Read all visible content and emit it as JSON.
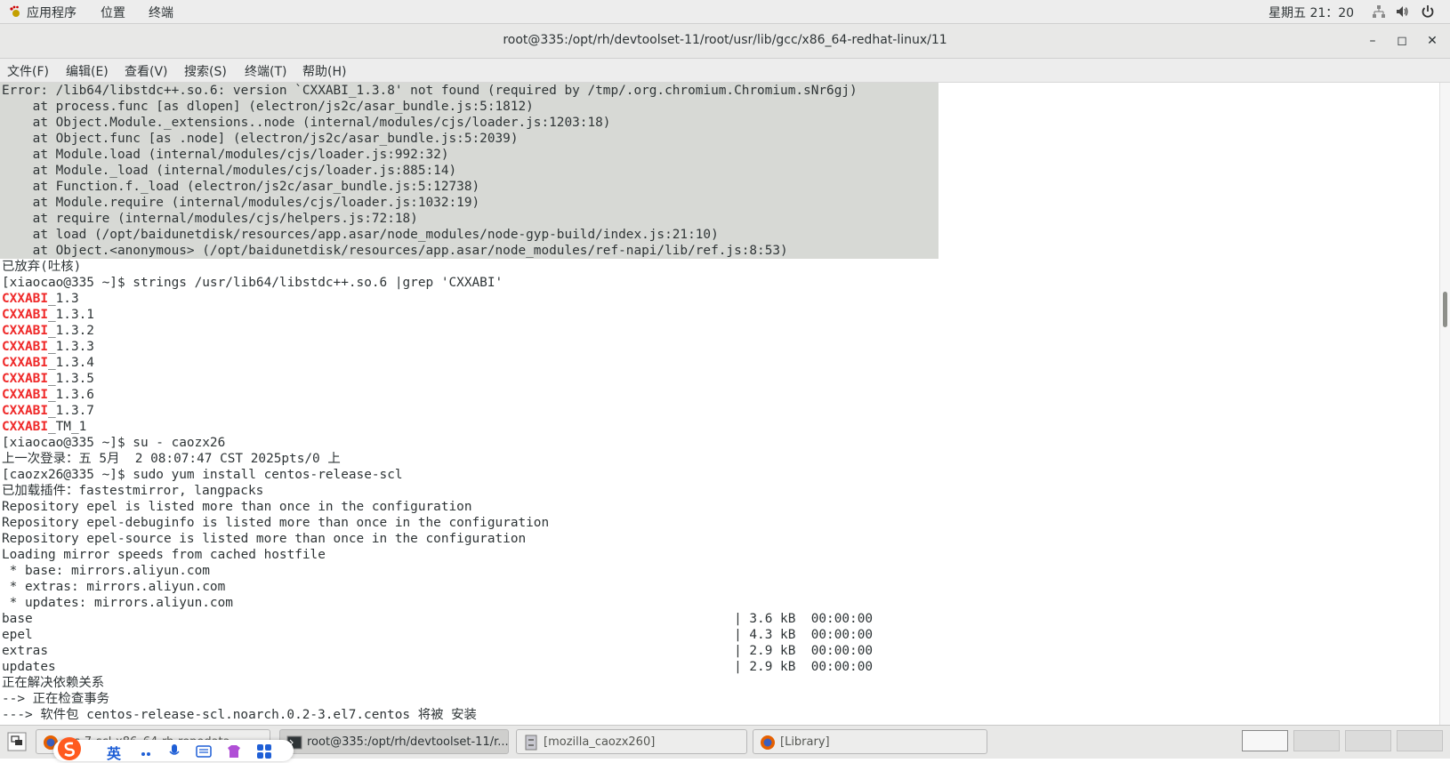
{
  "topbar": {
    "applications": "应用程序",
    "places": "位置",
    "terminal": "终端",
    "clock": "星期五 21：20"
  },
  "window": {
    "title": "root@335:/opt/rh/devtoolset-11/root/usr/lib/gcc/x86_64-redhat-linux/11",
    "minimize": "–",
    "maximize": "◻",
    "close": "✕"
  },
  "menubar": {
    "file": "文件(F)",
    "edit": "编辑(E)",
    "view": "查看(V)",
    "search": "搜索(S)",
    "terminal": "终端(T)",
    "help": "帮助(H)"
  },
  "terminal": {
    "lines": [
      {
        "text": "Error: /lib64/libstdc++.so.6: version `CXXABI_1.3.8' not found (required by /tmp/.org.chromium.Chromium.sNr6gj)"
      },
      {
        "text": "    at process.func [as dlopen] (electron/js2c/asar_bundle.js:5:1812)"
      },
      {
        "text": "    at Object.Module._extensions..node (internal/modules/cjs/loader.js:1203:18)"
      },
      {
        "text": "    at Object.func [as .node] (electron/js2c/asar_bundle.js:5:2039)"
      },
      {
        "text": "    at Module.load (internal/modules/cjs/loader.js:992:32)"
      },
      {
        "text": "    at Module._load (internal/modules/cjs/loader.js:885:14)"
      },
      {
        "text": "    at Function.f._load (electron/js2c/asar_bundle.js:5:12738)"
      },
      {
        "text": "    at Module.require (internal/modules/cjs/loader.js:1032:19)"
      },
      {
        "text": "    at require (internal/modules/cjs/helpers.js:72:18)"
      },
      {
        "text": "    at load (/opt/baidunetdisk/resources/app.asar/node_modules/node-gyp-build/index.js:21:10)"
      },
      {
        "text": "    at Object.<anonymous> (/opt/baidunetdisk/resources/app.asar/node_modules/ref-napi/lib/ref.js:8:53)"
      },
      {
        "text": "已放弃(吐核)"
      },
      {
        "text": "[xiaocao@335 ~]$ strings /usr/lib64/libstdc++.so.6 |grep 'CXXABI'"
      },
      {
        "hl": "CXXABI",
        "text": "_1.3"
      },
      {
        "hl": "CXXABI",
        "text": "_1.3.1"
      },
      {
        "hl": "CXXABI",
        "text": "_1.3.2"
      },
      {
        "hl": "CXXABI",
        "text": "_1.3.3"
      },
      {
        "hl": "CXXABI",
        "text": "_1.3.4"
      },
      {
        "hl": "CXXABI",
        "text": "_1.3.5"
      },
      {
        "hl": "CXXABI",
        "text": "_1.3.6"
      },
      {
        "hl": "CXXABI",
        "text": "_1.3.7"
      },
      {
        "hl": "CXXABI",
        "text": "_TM_1"
      },
      {
        "text": "[xiaocao@335 ~]$ su - caozx26"
      },
      {
        "text": "上一次登录：五 5月  2 08:07:47 CST 2025pts/0 上"
      },
      {
        "text": "[caozx26@335 ~]$ sudo yum install centos-release-scl"
      },
      {
        "text": "已加载插件：fastestmirror, langpacks"
      },
      {
        "text": "Repository epel is listed more than once in the configuration"
      },
      {
        "text": "Repository epel-debuginfo is listed more than once in the configuration"
      },
      {
        "text": "Repository epel-source is listed more than once in the configuration"
      },
      {
        "text": "Loading mirror speeds from cached hostfile"
      },
      {
        "text": " * base: mirrors.aliyun.com"
      },
      {
        "text": " * extras: mirrors.aliyun.com"
      },
      {
        "text": " * updates: mirrors.aliyun.com"
      },
      {
        "text": "base                                                                                           | 3.6 kB  00:00:00"
      },
      {
        "text": "epel                                                                                           | 4.3 kB  00:00:00"
      },
      {
        "text": "extras                                                                                         | 2.9 kB  00:00:00"
      },
      {
        "text": "updates                                                                                        | 2.9 kB  00:00:00"
      },
      {
        "text": "正在解决依赖关系"
      },
      {
        "text": "--> 正在检查事务"
      },
      {
        "text": "---> 软件包 centos-release-scl.noarch.0.2-3.el7.centos 将被 安装"
      }
    ]
  },
  "taskbar": {
    "tasks": [
      {
        "label": "...s-7-scl-x86_64-rh-repodata..."
      },
      {
        "label": "root@335:/opt/rh/devtoolset-11/r..."
      },
      {
        "label": "[mozilla_caozx260]"
      },
      {
        "label": "[Library]"
      }
    ]
  },
  "ime": {
    "lang": "英"
  },
  "colors": {
    "selection": "#d7d9d5",
    "highlight": "#ef2929",
    "text": "#2e3436"
  }
}
